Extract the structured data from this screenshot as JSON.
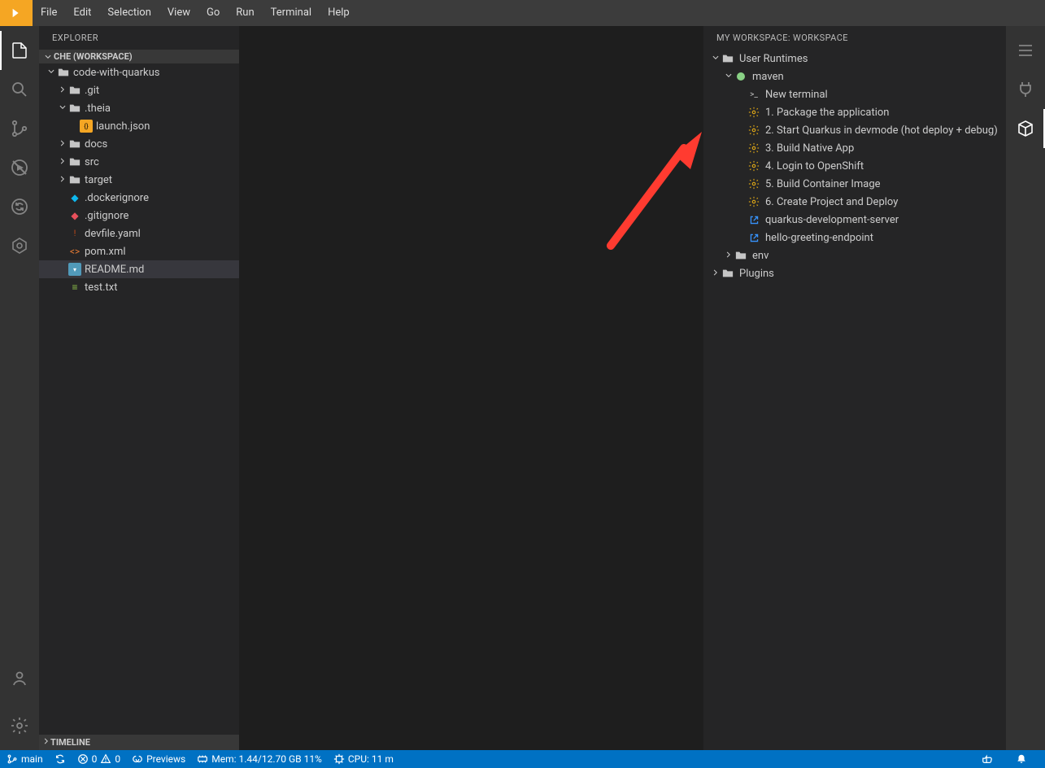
{
  "menubar": {
    "items": [
      "File",
      "Edit",
      "Selection",
      "View",
      "Go",
      "Run",
      "Terminal",
      "Help"
    ]
  },
  "explorer": {
    "title": "EXPLORER",
    "workspace_label": "CHE (WORKSPACE)",
    "tree": [
      {
        "indent": 0,
        "type": "folder",
        "label": "code-with-quarkus",
        "open": true
      },
      {
        "indent": 1,
        "type": "folder",
        "label": ".git",
        "open": false
      },
      {
        "indent": 1,
        "type": "folder",
        "label": ".theia",
        "open": true
      },
      {
        "indent": 2,
        "type": "file",
        "label": "launch.json",
        "icon": "json"
      },
      {
        "indent": 1,
        "type": "folder",
        "label": "docs",
        "open": false
      },
      {
        "indent": 1,
        "type": "folder",
        "label": "src",
        "open": false
      },
      {
        "indent": 1,
        "type": "folder",
        "label": "target",
        "open": false
      },
      {
        "indent": 1,
        "type": "file",
        "label": ".dockerignore",
        "icon": "docker"
      },
      {
        "indent": 1,
        "type": "file",
        "label": ".gitignore",
        "icon": "git"
      },
      {
        "indent": 1,
        "type": "file",
        "label": "devfile.yaml",
        "icon": "yaml"
      },
      {
        "indent": 1,
        "type": "file",
        "label": "pom.xml",
        "icon": "xml"
      },
      {
        "indent": 1,
        "type": "file",
        "label": "README.md",
        "icon": "md",
        "selected": true
      },
      {
        "indent": 1,
        "type": "file",
        "label": "test.txt",
        "icon": "txt"
      }
    ],
    "timeline_label": "TIMELINE"
  },
  "workspace_panel": {
    "title": "MY WORKSPACE: WORKSPACE",
    "items": [
      {
        "indent": 0,
        "type": "folder",
        "label": "User Runtimes",
        "open": true,
        "icon": "folder"
      },
      {
        "indent": 1,
        "type": "runtime",
        "label": "maven",
        "open": true,
        "icon": "dot"
      },
      {
        "indent": 2,
        "type": "cmd",
        "label": "New terminal",
        "icon": "terminal"
      },
      {
        "indent": 2,
        "type": "cmd",
        "label": "1. Package the application",
        "icon": "gear"
      },
      {
        "indent": 2,
        "type": "cmd",
        "label": "2. Start Quarkus in devmode (hot deploy + debug)",
        "icon": "gear"
      },
      {
        "indent": 2,
        "type": "cmd",
        "label": "3. Build Native App",
        "icon": "gear"
      },
      {
        "indent": 2,
        "type": "cmd",
        "label": "4. Login to OpenShift",
        "icon": "gear"
      },
      {
        "indent": 2,
        "type": "cmd",
        "label": "5. Build Container Image",
        "icon": "gear"
      },
      {
        "indent": 2,
        "type": "cmd",
        "label": "6. Create Project and Deploy",
        "icon": "gear"
      },
      {
        "indent": 2,
        "type": "link",
        "label": "quarkus-development-server",
        "icon": "link"
      },
      {
        "indent": 2,
        "type": "link",
        "label": "hello-greeting-endpoint",
        "icon": "link"
      },
      {
        "indent": 1,
        "type": "folder",
        "label": "env",
        "open": false,
        "icon": "folder"
      },
      {
        "indent": 0,
        "type": "folder",
        "label": "Plugins",
        "open": false,
        "icon": "folder"
      }
    ]
  },
  "statusbar": {
    "branch": "main",
    "errors": "0",
    "warnings": "0",
    "previews": "Previews",
    "mem": "Mem: 1.44/12.70 GB 11%",
    "cpu": "CPU: 11 m"
  }
}
